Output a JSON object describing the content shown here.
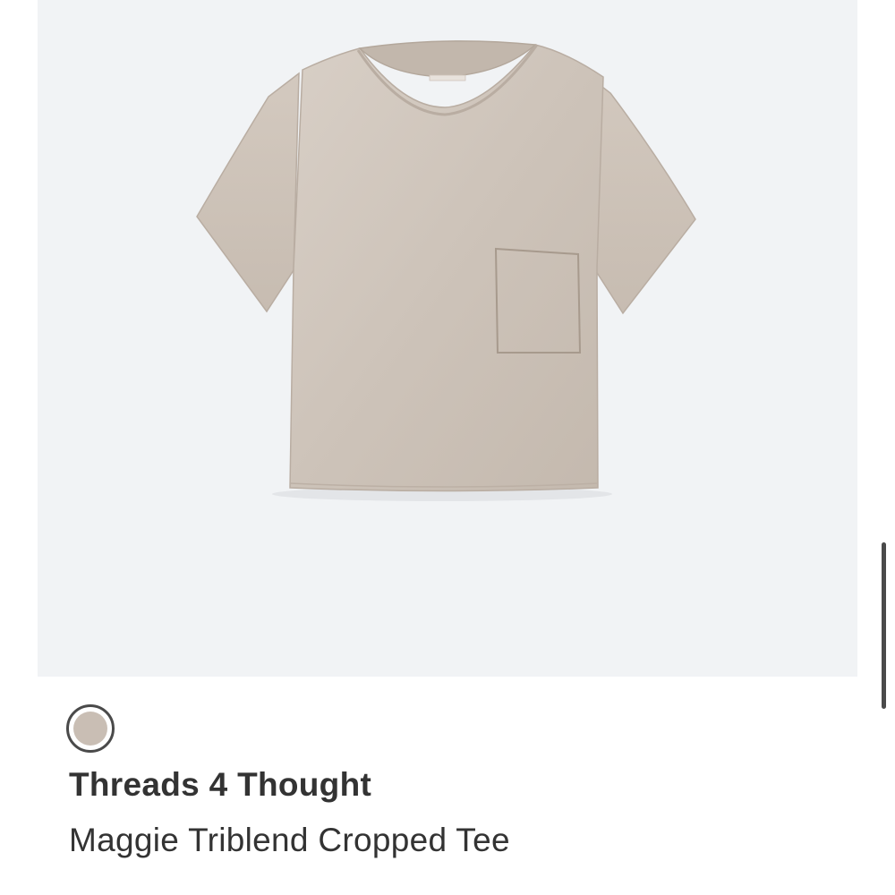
{
  "product": {
    "brand": "Threads 4 Thought",
    "name": "Maggie Triblend Cropped Tee",
    "image_icon": "tshirt-icon",
    "swatch": {
      "color": "#c9beb4",
      "ring_color": "#4a4a4a"
    }
  },
  "colors": {
    "image_background": "#f1f3f5",
    "text": "#333333",
    "scrollbar": "#4a4a4a"
  }
}
